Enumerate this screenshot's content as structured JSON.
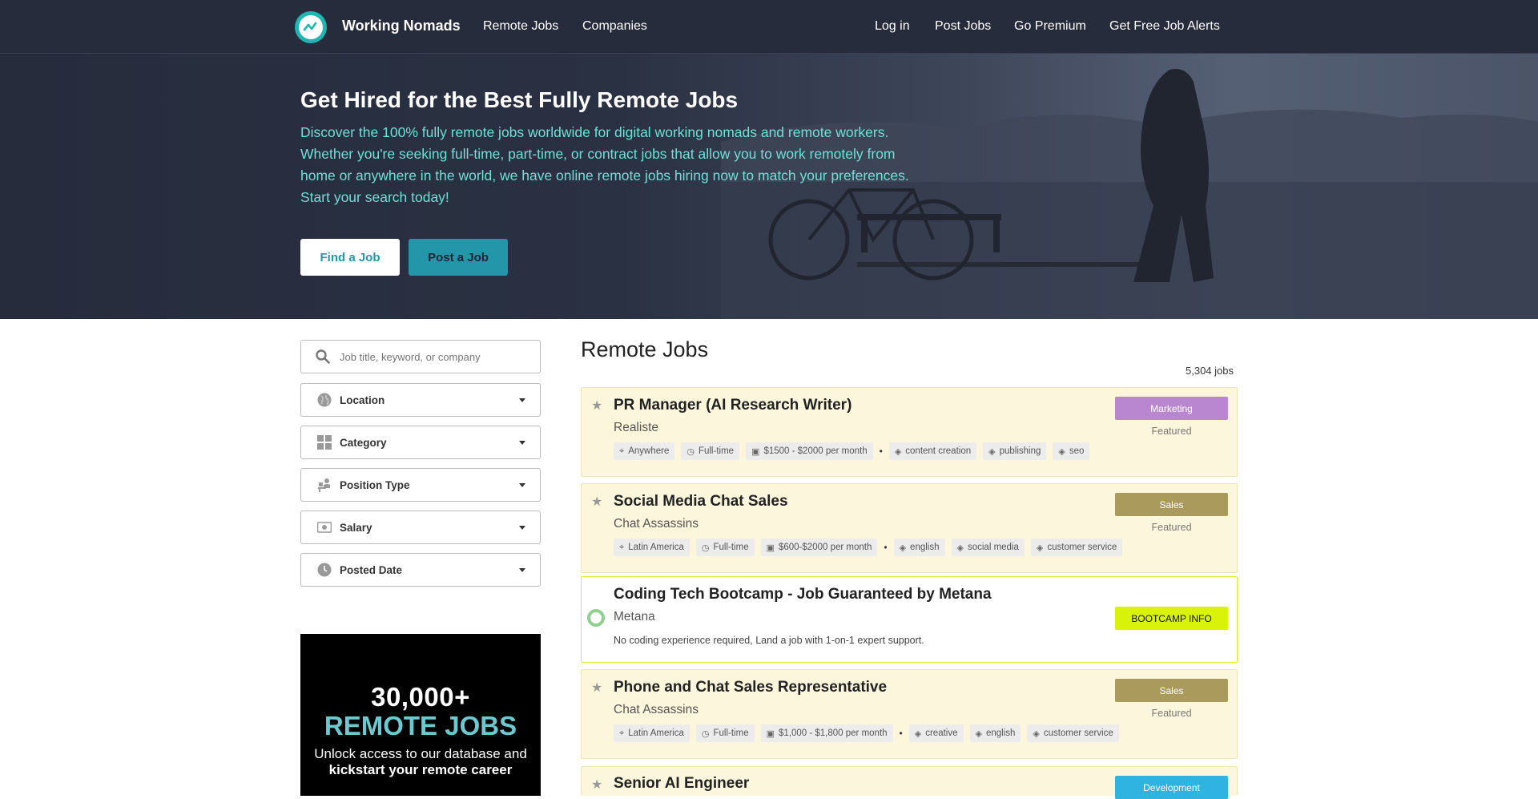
{
  "nav": {
    "brand": "Working Nomads",
    "links_left": [
      "Remote Jobs",
      "Companies"
    ],
    "links_right": [
      "Log in",
      "Post Jobs",
      "Go Premium",
      "Get Free Job Alerts"
    ]
  },
  "hero": {
    "title": "Get Hired for the Best Fully Remote Jobs",
    "description": "Discover the 100% fully remote jobs worldwide for digital working nomads and remote workers. Whether you're seeking full-time, part-time, or contract jobs that allow you to work remotely from home or anywhere in the world, we have online remote jobs hiring now to match your preferences. Start your search today!",
    "find_button": "Find a Job",
    "post_button": "Post a Job"
  },
  "sidebar": {
    "search_placeholder": "Job title, keyword, or company",
    "filters": [
      {
        "label": "Location",
        "icon": "globe-icon"
      },
      {
        "label": "Category",
        "icon": "grid-icon"
      },
      {
        "label": "Position Type",
        "icon": "person-desk-icon"
      },
      {
        "label": "Salary",
        "icon": "money-icon"
      },
      {
        "label": "Posted Date",
        "icon": "clock-icon"
      }
    ],
    "ad": {
      "line1": "30,000+",
      "line2": "REMOTE JOBS",
      "line3": "Unlock access to our database and",
      "line4": "kickstart your remote career"
    }
  },
  "main": {
    "title": "Remote Jobs",
    "count": "5,304 jobs",
    "jobs": [
      {
        "title": "PR Manager (AI Research Writer)",
        "company": "Realiste",
        "category": "Marketing",
        "category_color": "#b887cf",
        "featured": "Featured",
        "meta": [
          "Anywhere",
          "Full-time",
          "$1500 - $2000 per month"
        ],
        "tags": [
          "content creation",
          "publishing",
          "seo"
        ]
      },
      {
        "title": "Social Media Chat Sales",
        "company": "Chat Assassins",
        "category": "Sales",
        "category_color": "#aa9b5c",
        "featured": "Featured",
        "meta": [
          "Latin America",
          "Full-time",
          "$600-$2000 per month"
        ],
        "tags": [
          "english",
          "social media",
          "customer service"
        ]
      },
      {
        "title": "Coding Tech Bootcamp - Job Guaranteed by Metana",
        "company": "Metana",
        "category": "BOOTCAMP INFO",
        "category_color": "#d8f20a",
        "description": "No coding experience required, Land a job with 1-on-1 expert support."
      },
      {
        "title": "Phone and Chat Sales Representative",
        "company": "Chat Assassins",
        "category": "Sales",
        "category_color": "#aa9b5c",
        "featured": "Featured",
        "meta": [
          "Latin America",
          "Full-time",
          "$1,000 - $1,800 per month"
        ],
        "tags": [
          "creative",
          "english",
          "customer service"
        ]
      },
      {
        "title": "Senior AI Engineer",
        "category": "Development",
        "category_color": "#2fb3e0"
      }
    ]
  }
}
